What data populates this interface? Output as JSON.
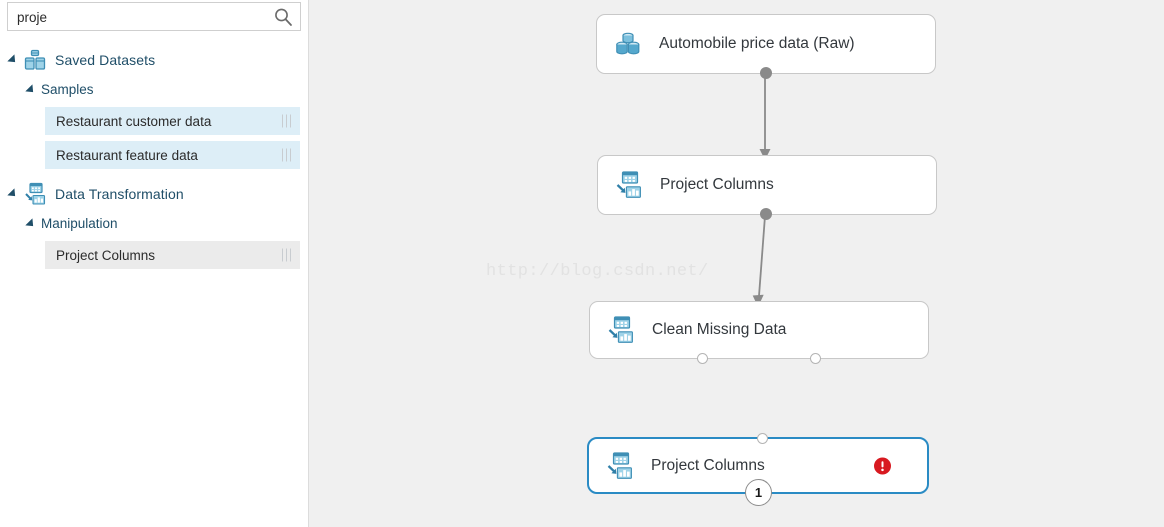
{
  "sidebar": {
    "search": {
      "value": "proje",
      "placeholder": "Search experiment items",
      "icon": "search-icon"
    },
    "tree": [
      {
        "label": "Saved Datasets",
        "level": 0,
        "icon": "datasets-icon",
        "expanded": true
      },
      {
        "label": "Samples",
        "level": 1,
        "expanded": true
      },
      {
        "label": "Restaurant customer data",
        "level": 2,
        "kind": "dataset",
        "handle": "drag-handle"
      },
      {
        "label": "Restaurant feature data",
        "level": 2,
        "kind": "dataset",
        "handle": "drag-handle"
      },
      {
        "label": "Data Transformation",
        "level": 0,
        "icon": "data-transformation-icon",
        "expanded": true
      },
      {
        "label": "Manipulation",
        "level": 1,
        "expanded": true
      },
      {
        "label": "Project Columns",
        "level": 2,
        "kind": "module",
        "handle": "drag-handle"
      }
    ]
  },
  "canvas": {
    "watermark": "http://blog.csdn.net/",
    "nodes": [
      {
        "id": "automobile-price-data-raw",
        "label": "Automobile price data (Raw)",
        "icon": "dataset-icon",
        "selected": false,
        "error": false,
        "count_badge": null,
        "inputs": 0,
        "outputs": 1
      },
      {
        "id": "project-columns-1",
        "label": "Project Columns",
        "icon": "data-transformation-icon",
        "selected": false,
        "error": false,
        "count_badge": null,
        "inputs": 1,
        "outputs": 1
      },
      {
        "id": "clean-missing-data",
        "label": "Clean Missing Data",
        "icon": "data-transformation-icon",
        "selected": false,
        "error": false,
        "count_badge": null,
        "inputs": 1,
        "outputs": 2
      },
      {
        "id": "project-columns-2",
        "label": "Project Columns",
        "icon": "data-transformation-icon",
        "selected": true,
        "error": true,
        "count_badge": "1",
        "inputs": 1,
        "outputs": 0
      }
    ],
    "edges": [
      {
        "from": "automobile-price-data-raw",
        "to": "project-columns-1"
      },
      {
        "from": "project-columns-1",
        "to": "clean-missing-data"
      }
    ]
  },
  "colors": {
    "accent": "#2a8bc4",
    "icon_blue": "#4a9bc4",
    "tree_text": "#1f4e68",
    "error_red": "#d81920",
    "canvas_bg": "#f0f0f0",
    "dataset_row_bg": "#ddeef7",
    "module_row_bg": "#ebebeb",
    "connector_gray": "#8a8a8a"
  }
}
